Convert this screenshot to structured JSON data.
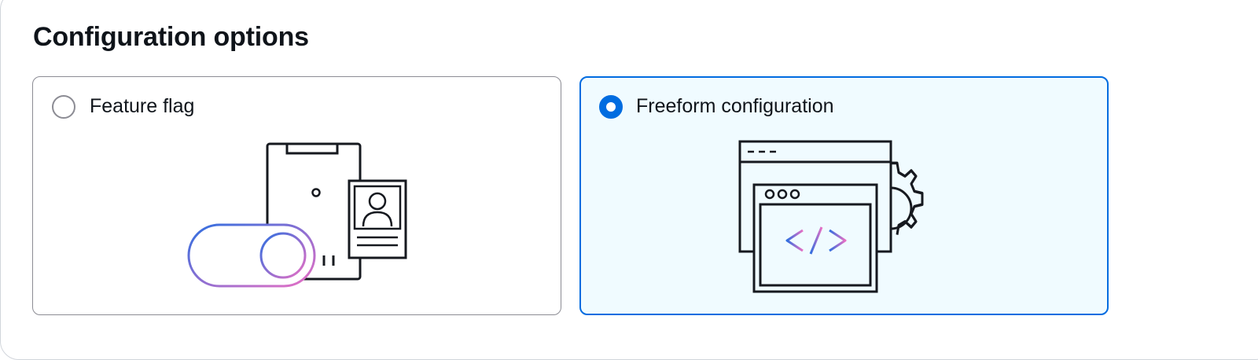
{
  "section": {
    "title": "Configuration options"
  },
  "options": [
    {
      "label": "Feature flag",
      "selected": false,
      "icon": "feature-flag-illustration-icon"
    },
    {
      "label": "Freeform configuration",
      "selected": true,
      "icon": "freeform-configuration-illustration-icon"
    }
  ],
  "colors": {
    "accent": "#006ce0",
    "selected_bg": "#f0fbff",
    "border": "#8c8c94",
    "text": "#0f141a",
    "gradient_start": "#2f6fe0",
    "gradient_end": "#e86fc4"
  }
}
